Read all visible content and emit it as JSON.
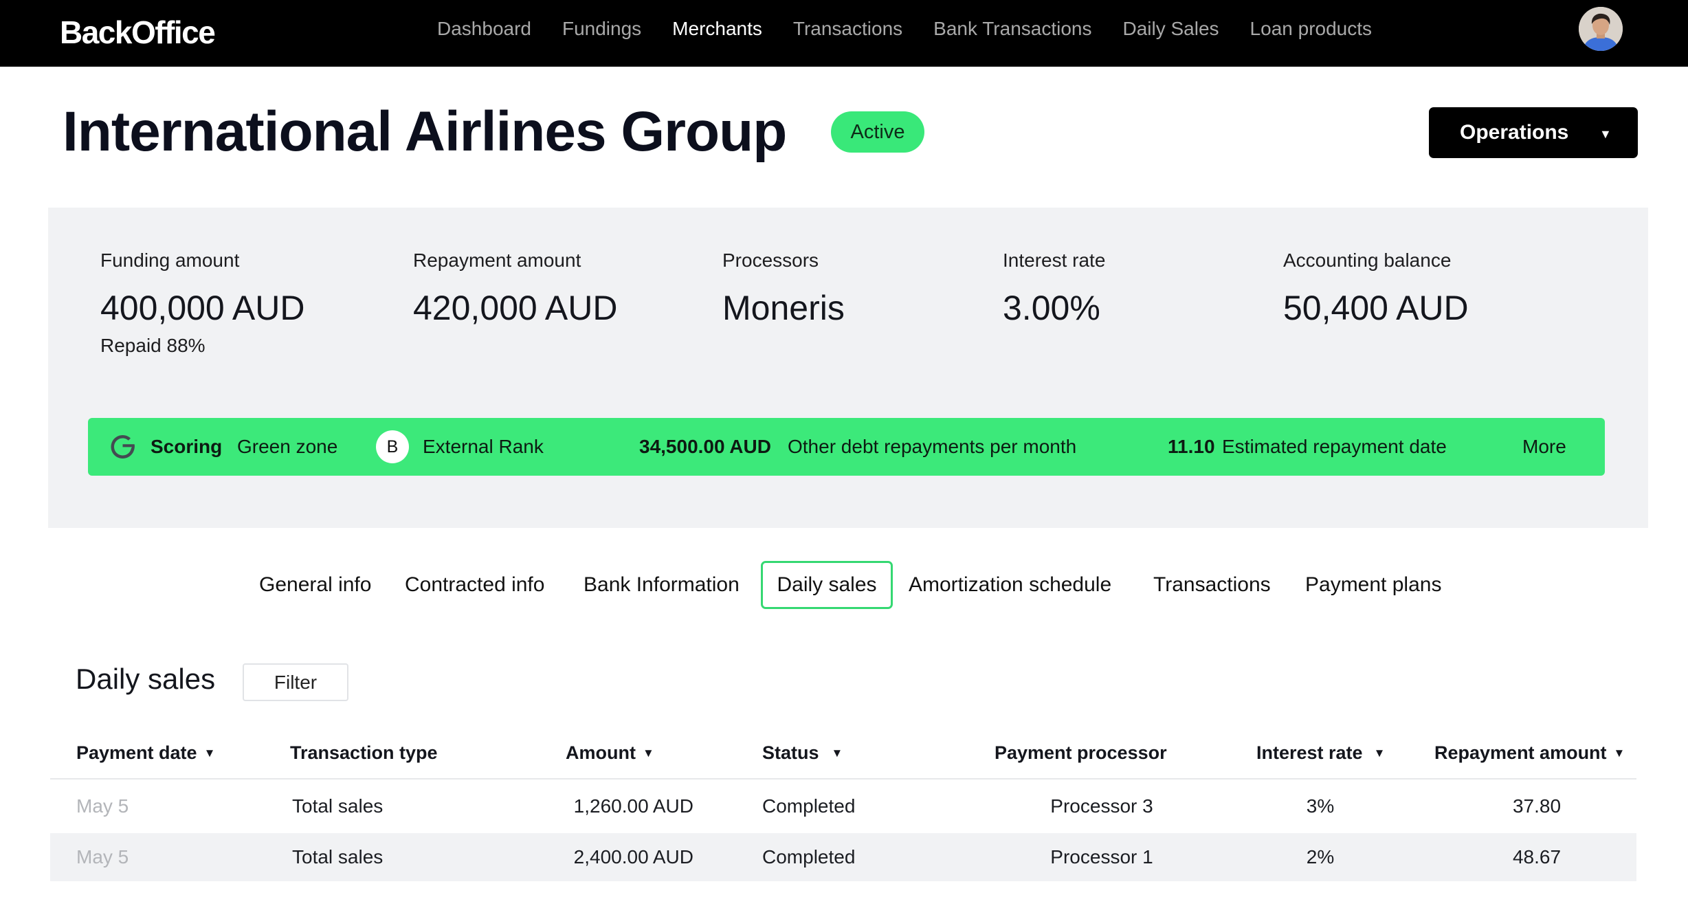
{
  "app": {
    "logo": "BackOffice"
  },
  "nav": {
    "items": [
      {
        "label": "Dashboard"
      },
      {
        "label": "Fundings"
      },
      {
        "label": "Merchants"
      },
      {
        "label": "Transactions"
      },
      {
        "label": "Bank Transactions"
      },
      {
        "label": "Daily Sales"
      },
      {
        "label": "Loan products"
      }
    ],
    "active": "Merchants"
  },
  "header": {
    "title": "International Airlines Group",
    "status": "Active",
    "operations_label": "Operations"
  },
  "summary": {
    "funding": {
      "label": "Funding amount",
      "value": "400,000 AUD",
      "sub": "Repaid 88%"
    },
    "repayment": {
      "label": "Repayment amount",
      "value": "420,000 AUD"
    },
    "processors": {
      "label": "Processors",
      "value": "Moneris"
    },
    "interest": {
      "label": "Interest rate",
      "value": "3.00%"
    },
    "balance": {
      "label": "Accounting balance",
      "value": "50,400 AUD"
    }
  },
  "scoring": {
    "scoring_label": "Scoring",
    "zone": "Green zone",
    "rank_letter": "B",
    "rank_label": "External Rank",
    "debt_value": "34,500.00 AUD",
    "debt_label": "Other debt repayments per month",
    "date_value": "11.10",
    "date_label": "Estimated repayment date",
    "more_label": "More"
  },
  "tabs": [
    {
      "label": "General info"
    },
    {
      "label": "Contracted info"
    },
    {
      "label": "Bank Information"
    },
    {
      "label": "Daily sales"
    },
    {
      "label": "Amortization schedule"
    },
    {
      "label": "Transactions"
    },
    {
      "label": "Payment plans"
    }
  ],
  "active_tab": "Daily sales",
  "section": {
    "title": "Daily sales",
    "filter_label": "Filter"
  },
  "table": {
    "columns": [
      {
        "label": "Payment date",
        "sortable": true
      },
      {
        "label": "Transaction type",
        "sortable": false
      },
      {
        "label": "Amount",
        "sortable": true
      },
      {
        "label": "Status",
        "sortable": true
      },
      {
        "label": "Payment processor",
        "sortable": false
      },
      {
        "label": "Interest rate",
        "sortable": true
      },
      {
        "label": "Repayment amount",
        "sortable": true
      }
    ],
    "sort_glyph": "▼",
    "rows": [
      {
        "date": "May 5",
        "type": "Total sales",
        "amount": "1,260.00 AUD",
        "status": "Completed",
        "processor": "Processor 3",
        "rate": "3%",
        "repayment": "37.80"
      },
      {
        "date": "May 5",
        "type": "Total sales",
        "amount": "2,400.00 AUD",
        "status": "Completed",
        "processor": "Processor 1",
        "rate": "2%",
        "repayment": "48.67"
      }
    ]
  },
  "colors": {
    "accent_green": "#3ce97a",
    "topbar": "#000000",
    "panel": "#f1f2f4",
    "tab_border": "#35d872",
    "google_blue": "#4285f4"
  }
}
